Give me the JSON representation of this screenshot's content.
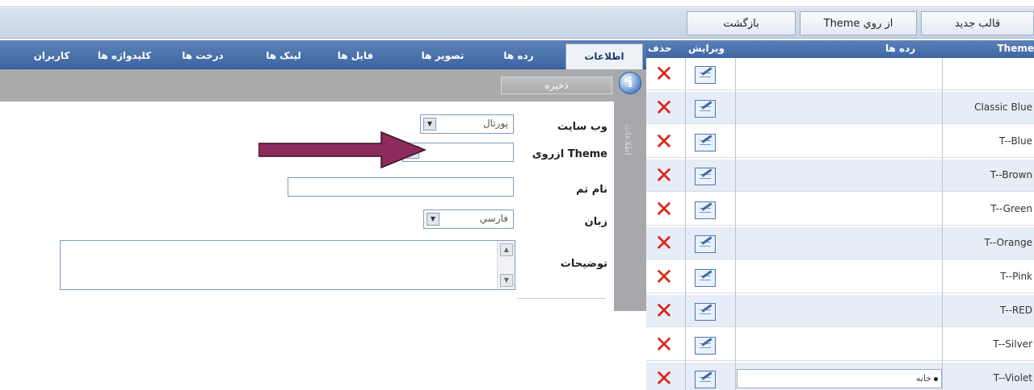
{
  "toolbar": {
    "new_template": "قالب جديد",
    "from_theme": "Theme از روي",
    "back": "بازگشت"
  },
  "tabs": [
    {
      "label": "اطلاعات"
    },
    {
      "label": "رده ها"
    },
    {
      "label": "تصوير ها"
    },
    {
      "label": "فايل ها"
    },
    {
      "label": "لينک ها"
    },
    {
      "label": "درخت ها"
    },
    {
      "label": "کليدواژه ها"
    },
    {
      "label": "کاربران"
    }
  ],
  "form": {
    "save_label": "ذخيره",
    "side_label": "اطلاعات",
    "website_label": "وب سايت",
    "website_value": "پورتال",
    "from_theme_label": "ازروی Theme",
    "theme_name_label": "نام تم",
    "theme_name_value": "",
    "language_label": "زبان",
    "language_value": "فارسي",
    "description_label": "توضيحات",
    "description_value": ""
  },
  "grid": {
    "headers": {
      "delete": "حذف",
      "edit": "ويرايش",
      "categories": "رده ها",
      "theme": "Theme"
    },
    "rows": [
      {
        "theme": ""
      },
      {
        "theme": "Classic Blue"
      },
      {
        "theme": "T--Blue"
      },
      {
        "theme": "T--Brown"
      },
      {
        "theme": "T--Green"
      },
      {
        "theme": "T--Orange"
      },
      {
        "theme": "T--Pink"
      },
      {
        "theme": "T--RED"
      },
      {
        "theme": "T--Silver"
      },
      {
        "theme": "T--Violet"
      }
    ],
    "category_item": "خانه"
  },
  "colors": {
    "tab_bar": "#3d65a0",
    "grid_alt_row": "#e7edf6",
    "delete_icon": "#d8261b",
    "annotation_arrow": "#8b2c5c"
  },
  "icons": {
    "delete": "close-x-icon",
    "edit": "edit-notepad-icon",
    "info": "info-icon"
  }
}
